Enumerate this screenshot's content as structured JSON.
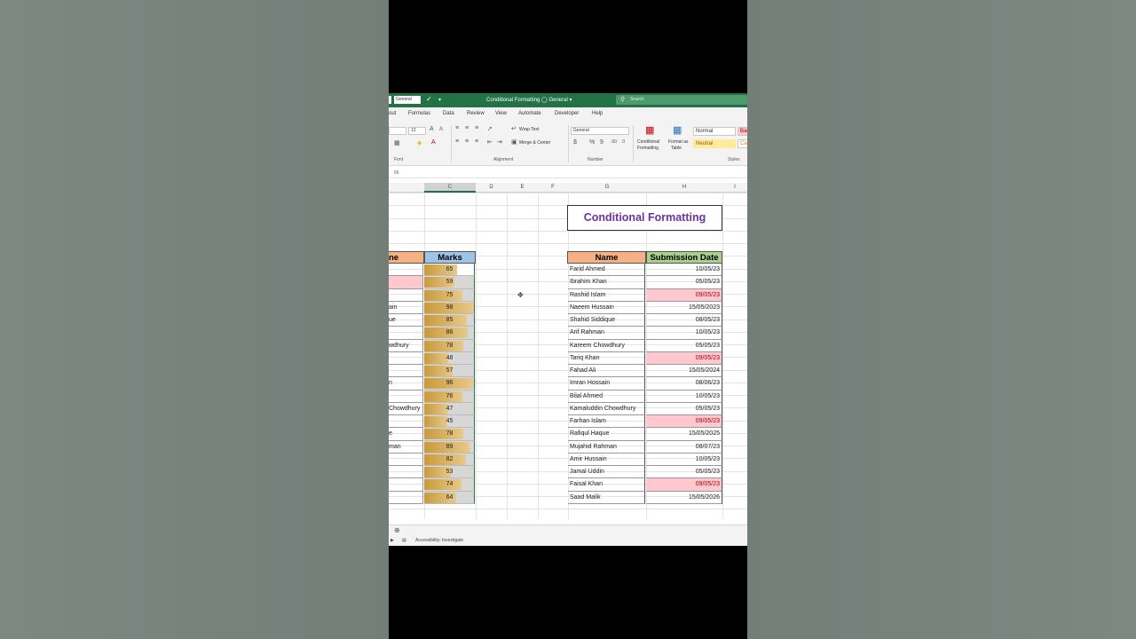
{
  "titlebar": {
    "style_value": "General",
    "doc_title": "Conditional Formatting",
    "sensitivity": "General",
    "search_placeholder": "Search"
  },
  "tabs": [
    "out",
    "Formulas",
    "Data",
    "Review",
    "View",
    "Automate",
    "Developer",
    "Help"
  ],
  "ribbon": {
    "font_size": "12",
    "wrap_text": "Wrap Text",
    "merge_center": "Merge & Center",
    "number_format": "General",
    "cond_format_1": "Conditional",
    "cond_format_2": "Formatting",
    "format_table_1": "Format as",
    "format_table_2": "Table",
    "style_normal": "Normal",
    "style_bad": "Bad",
    "style_neutral": "Neutral",
    "style_calc": "Cal",
    "groups": {
      "font": "Font",
      "alignment": "Alignment",
      "number": "Number",
      "styles": "Styles"
    }
  },
  "formula_bar": {
    "value": "65"
  },
  "columns": [
    "C",
    "D",
    "E",
    "F",
    "G",
    "H",
    "I"
  ],
  "title": "Conditional Formatting",
  "left_table": {
    "name_header": "ne",
    "marks_header": "Marks",
    "names": [
      "",
      "",
      "",
      "ain",
      "ue",
      "",
      "wdhury",
      "",
      "",
      "n",
      "",
      "Chowdhury",
      "",
      "e",
      "man",
      "",
      "",
      "",
      ""
    ],
    "name_highlight": [
      false,
      true,
      false,
      false,
      false,
      false,
      false,
      false,
      false,
      false,
      false,
      false,
      false,
      false,
      false,
      false,
      false,
      false,
      false
    ],
    "marks": [
      65,
      59,
      75,
      98,
      85,
      86,
      78,
      48,
      57,
      96,
      76,
      47,
      45,
      78,
      89,
      82,
      53,
      74,
      64
    ],
    "marks_max": 100,
    "bar_color": "#c99a3b"
  },
  "right_table": {
    "name_header": "Name",
    "date_header": "Submission Date",
    "name_header_color": "#f4b183",
    "date_header_color": "#a9d08e",
    "highlight_color": "#ffc7ce",
    "rows": [
      {
        "name": "Farid Ahmed",
        "date": "10/05/23",
        "highlight": false
      },
      {
        "name": "Ibrahim Khan",
        "date": "05/05/23",
        "highlight": false
      },
      {
        "name": "Rashid Islam",
        "date": "09/05/23",
        "highlight": true
      },
      {
        "name": "Naeem Hussain",
        "date": "15/05/2023",
        "highlight": false
      },
      {
        "name": "Shahid Siddique",
        "date": "08/05/23",
        "highlight": false
      },
      {
        "name": "Arif Rahman",
        "date": "10/05/23",
        "highlight": false
      },
      {
        "name": "Kareem Chowdhury",
        "date": "05/05/23",
        "highlight": false
      },
      {
        "name": "Tariq Khan",
        "date": "09/05/23",
        "highlight": true
      },
      {
        "name": "Fahad Ali",
        "date": "15/05/2024",
        "highlight": false
      },
      {
        "name": "Imran Hossain",
        "date": "08/06/23",
        "highlight": false
      },
      {
        "name": "Bilal Ahmed",
        "date": "10/05/23",
        "highlight": false
      },
      {
        "name": "Kamaluddin Chowdhury",
        "date": "05/05/23",
        "highlight": false
      },
      {
        "name": "Farhan Islam",
        "date": "09/05/23",
        "highlight": true
      },
      {
        "name": "Rafiqul Haque",
        "date": "15/05/2025",
        "highlight": false
      },
      {
        "name": "Mujahid Rahman",
        "date": "08/07/23",
        "highlight": false
      },
      {
        "name": "Amir Hussain",
        "date": "10/05/23",
        "highlight": false
      },
      {
        "name": "Jamal Uddin",
        "date": "05/05/23",
        "highlight": false
      },
      {
        "name": "Faisal Khan",
        "date": "09/05/23",
        "highlight": true
      },
      {
        "name": "Saad Malik",
        "date": "15/05/2026",
        "highlight": false
      }
    ]
  },
  "statusbar": {
    "accessibility": "Accessibility: Investigate"
  }
}
